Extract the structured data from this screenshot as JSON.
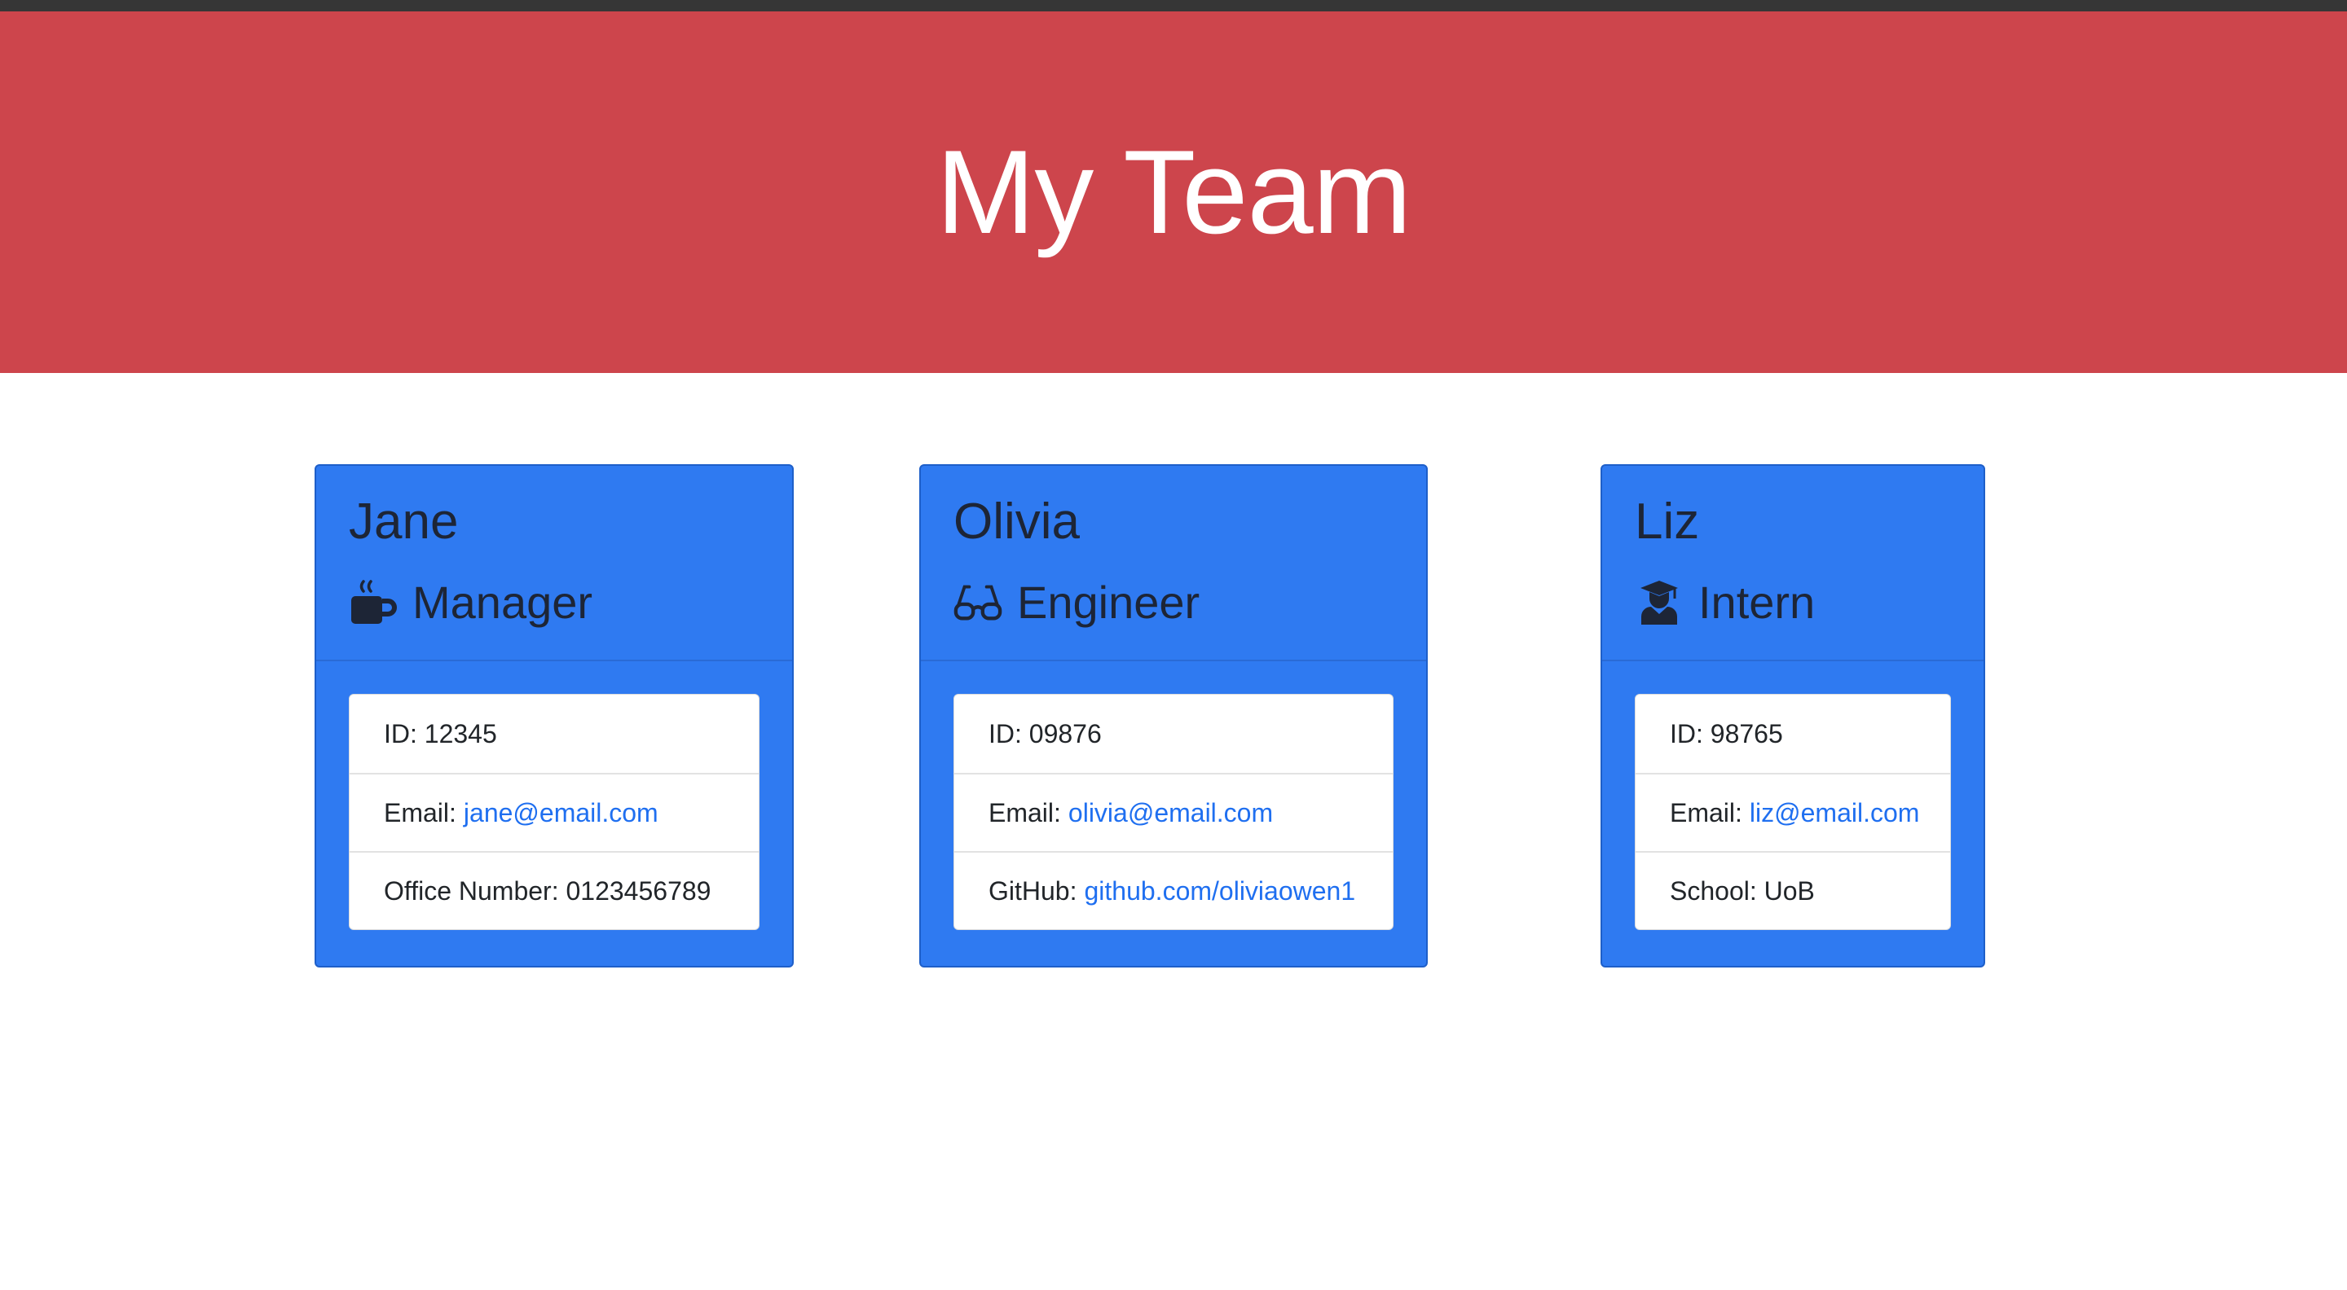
{
  "header": {
    "title": "My Team"
  },
  "cards": [
    {
      "name": "Jane",
      "role": "Manager",
      "icon": "coffee-mug-icon",
      "id_label": "ID:",
      "id_value": "12345",
      "email_label": "Email:",
      "email_value": "jane@email.com",
      "extra_label": "Office Number:",
      "extra_value": "0123456789"
    },
    {
      "name": "Olivia",
      "role": "Engineer",
      "icon": "glasses-icon",
      "id_label": "ID:",
      "id_value": "09876",
      "email_label": "Email:",
      "email_value": "olivia@email.com",
      "extra_label": "GitHub:",
      "extra_value": "github.com/oliviaowen1"
    },
    {
      "name": "Liz",
      "role": "Intern",
      "icon": "graduate-icon",
      "id_label": "ID:",
      "id_value": "98765",
      "email_label": "Email:",
      "email_value": "liz@email.com",
      "extra_label": "School:",
      "extra_value": "UoB"
    }
  ],
  "colors": {
    "header_bg": "#cd454c",
    "card_bg": "#2f7af1",
    "link": "#1f6ff0"
  }
}
